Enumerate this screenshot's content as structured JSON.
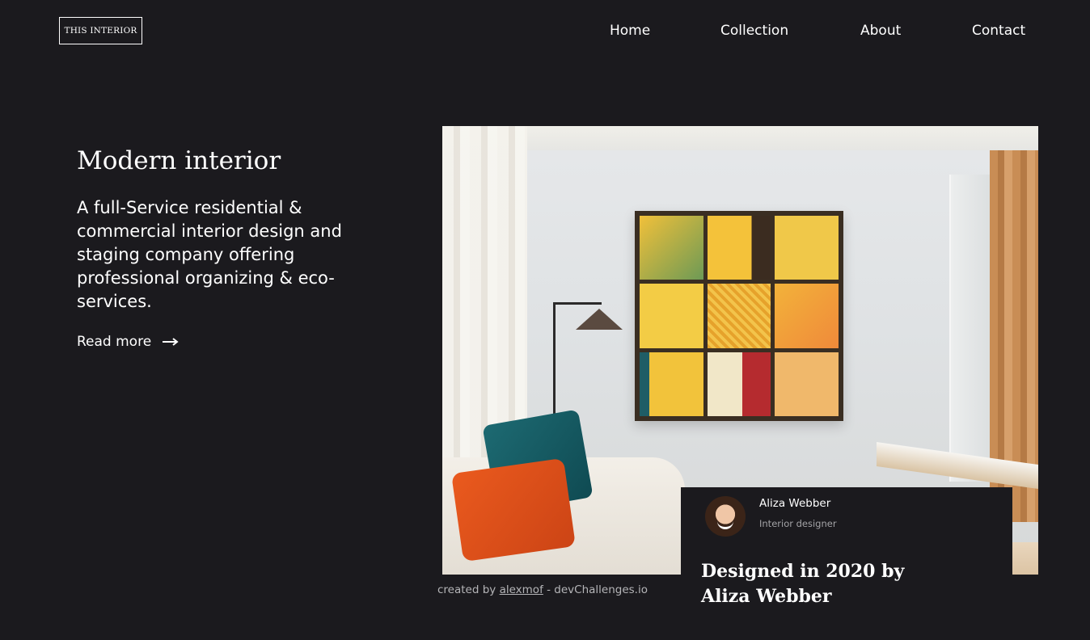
{
  "header": {
    "logo_text": "THIS INTERIOR",
    "nav": [
      {
        "label": "Home"
      },
      {
        "label": "Collection"
      },
      {
        "label": "About"
      },
      {
        "label": "Contact"
      }
    ]
  },
  "hero": {
    "title": "Modern interior",
    "description": "A full-Service residential & commercial interior design and staging company offering professional organizing & eco-services.",
    "read_more_label": "Read more",
    "image_icon": "living-room-photo"
  },
  "designer_card": {
    "name": "Aliza Webber",
    "role": "Interior designer",
    "heading": "Designed in 2020 by Aliza Webber",
    "avatar_icon": "designer-avatar"
  },
  "credit": {
    "prefix": "created by ",
    "author": "alexmof",
    "suffix": " - devChallenges.io"
  },
  "colors": {
    "background": "#1b1a1e",
    "text": "#ffffff",
    "muted": "#a3a3a6"
  }
}
